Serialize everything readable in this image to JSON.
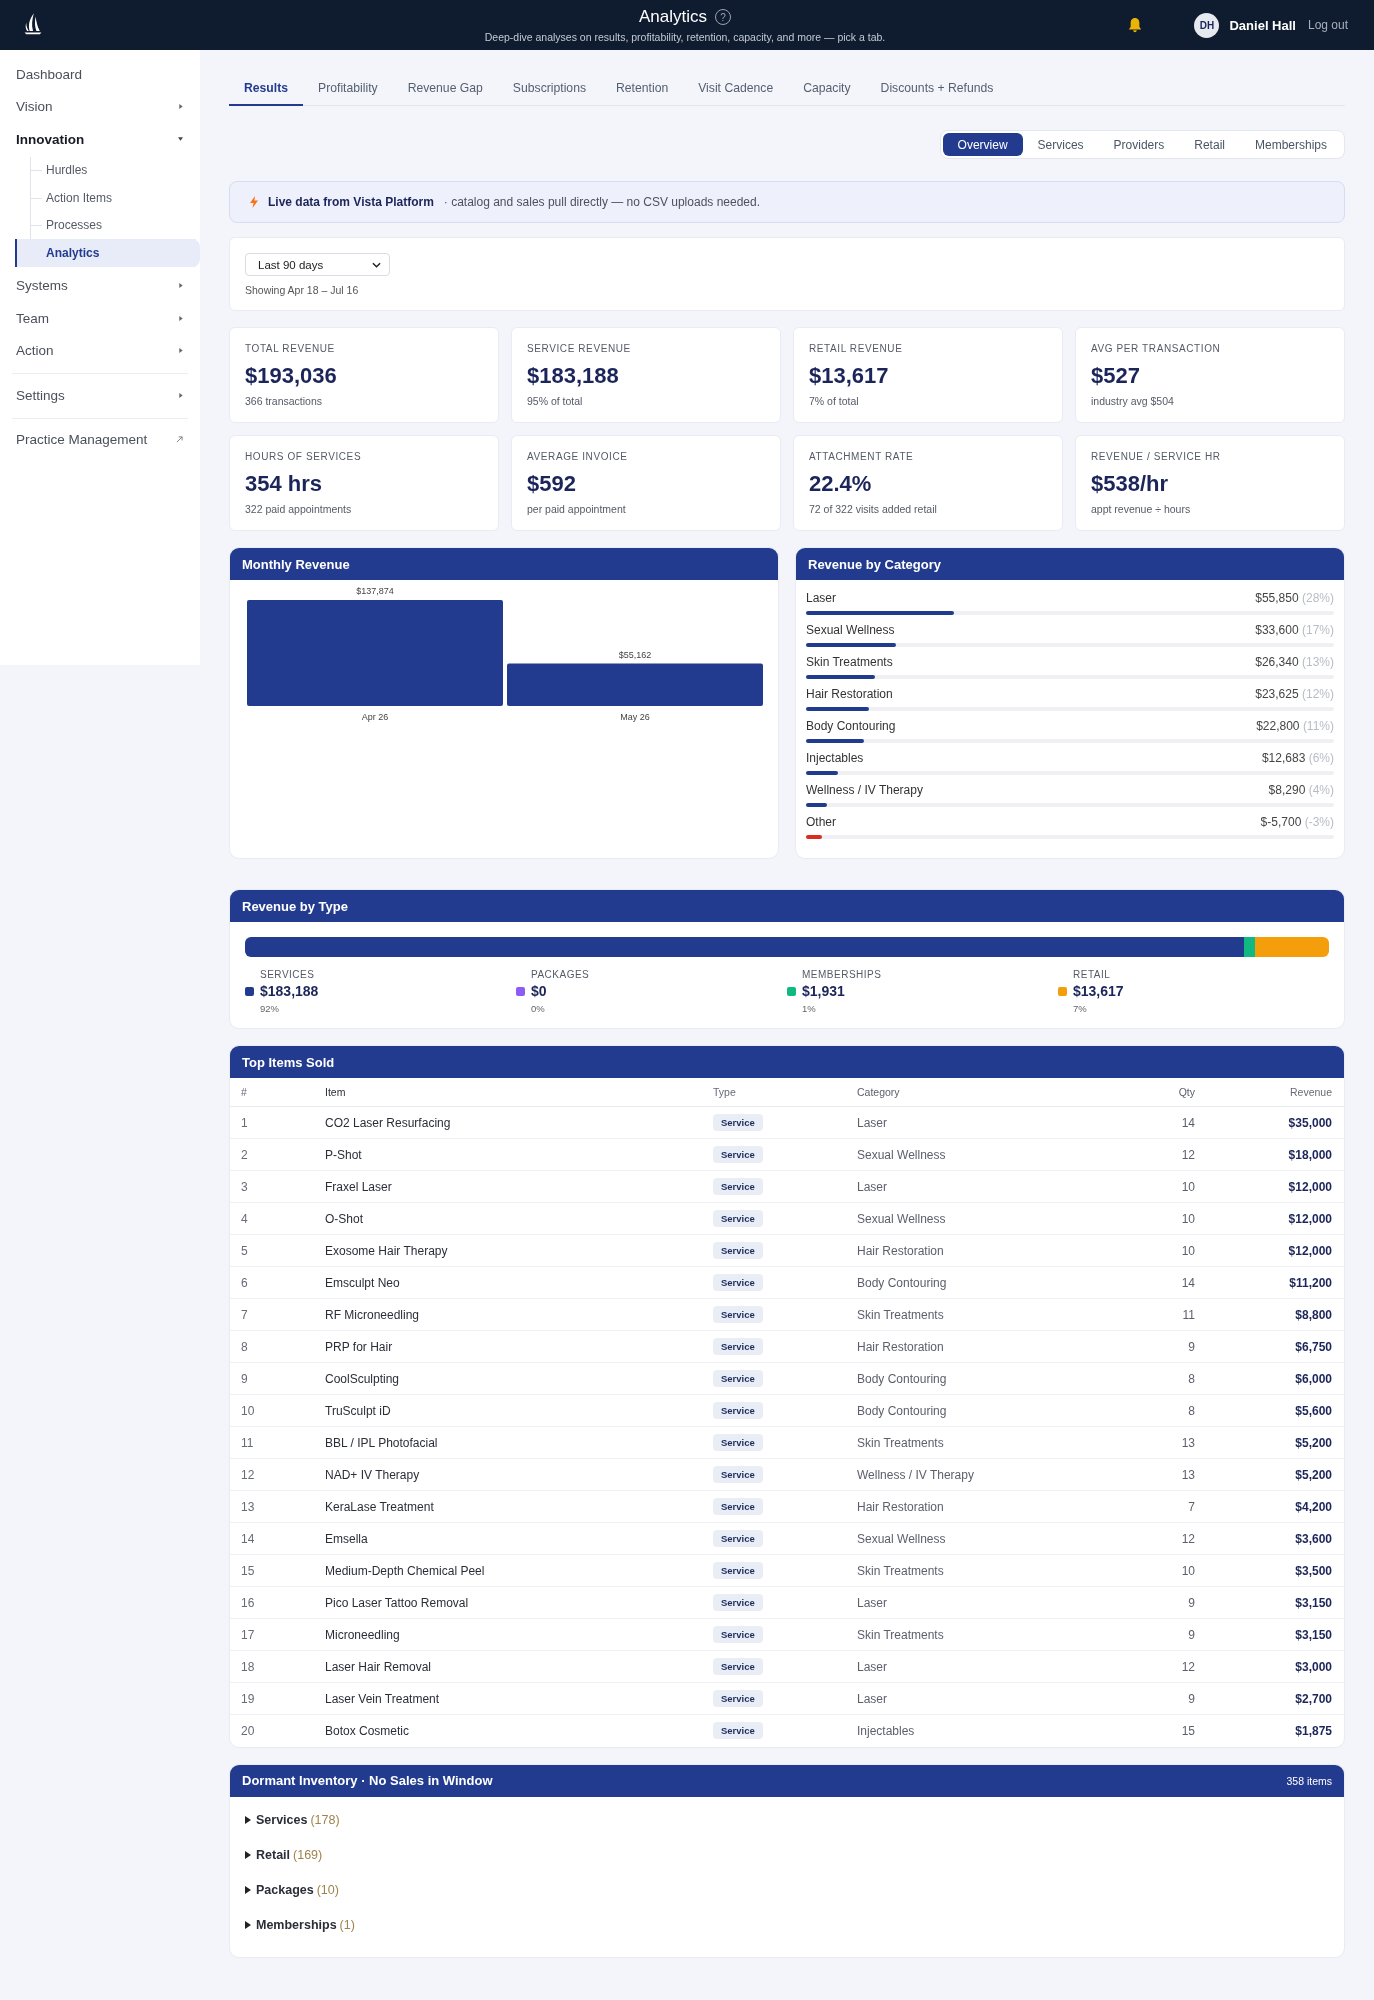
{
  "header": {
    "title": "Analytics",
    "help_button": "?",
    "subtitle": "Deep-dive analyses on results, profitability, retention, capacity, and more — pick a tab.",
    "user": {
      "initials": "DH",
      "name": "Daniel Hall"
    },
    "logout": "Log out"
  },
  "sidebar": {
    "sections": [
      {
        "items": [
          {
            "label": "Dashboard",
            "kind": "link",
            "selected": false
          },
          {
            "label": "Vision",
            "kind": "group",
            "expanded": false,
            "selected": false
          },
          {
            "label": "Innovation",
            "kind": "group",
            "expanded": true,
            "selected": false,
            "children": [
              {
                "label": "Hurdles",
                "selected": false
              },
              {
                "label": "Action Items",
                "selected": false
              },
              {
                "label": "Processes",
                "selected": false
              },
              {
                "label": "Analytics",
                "selected": true
              }
            ]
          },
          {
            "label": "Systems",
            "kind": "group",
            "expanded": false,
            "selected": false
          },
          {
            "label": "Team",
            "kind": "group",
            "expanded": false,
            "selected": false
          },
          {
            "label": "Action",
            "kind": "group",
            "expanded": false,
            "selected": false
          }
        ]
      },
      {
        "items": [
          {
            "label": "Settings",
            "kind": "group",
            "expanded": false,
            "selected": false
          }
        ]
      },
      {
        "items": [
          {
            "label": "Practice Management",
            "kind": "external",
            "selected": false
          }
        ]
      }
    ]
  },
  "tabs": [
    {
      "label": "Results",
      "selected": true
    },
    {
      "label": "Profitability",
      "selected": false
    },
    {
      "label": "Revenue Gap",
      "selected": false
    },
    {
      "label": "Subscriptions",
      "selected": false
    },
    {
      "label": "Retention",
      "selected": false
    },
    {
      "label": "Visit Cadence",
      "selected": false
    },
    {
      "label": "Capacity",
      "selected": false
    },
    {
      "label": "Discounts + Refunds",
      "selected": false
    }
  ],
  "subtabs": [
    {
      "label": "Overview",
      "selected": true
    },
    {
      "label": "Services",
      "selected": false
    },
    {
      "label": "Providers",
      "selected": false
    },
    {
      "label": "Retail",
      "selected": false
    },
    {
      "label": "Memberships",
      "selected": false
    }
  ],
  "banner": {
    "title": "Live data from Vista Platform",
    "text": "· catalog and sales pull directly — no CSV uploads needed."
  },
  "filter": {
    "period": "Last 90 days",
    "range": "Showing Apr 18 – Jul 16"
  },
  "kpis": [
    {
      "label": "TOTAL REVENUE",
      "value": "$193,036",
      "note": "366 transactions"
    },
    {
      "label": "SERVICE REVENUE",
      "value": "$183,188",
      "note": "95% of total"
    },
    {
      "label": "RETAIL REVENUE",
      "value": "$13,617",
      "note": "7% of total"
    },
    {
      "label": "AVG PER TRANSACTION",
      "value": "$527",
      "note": "industry avg $504"
    },
    {
      "label": "HOURS OF SERVICES",
      "value": "354 hrs",
      "note": "322 paid appointments"
    },
    {
      "label": "AVERAGE INVOICE",
      "value": "$592",
      "note": "per paid appointment"
    },
    {
      "label": "ATTACHMENT RATE",
      "value": "22.4%",
      "note": "72 of 322 visits added retail"
    },
    {
      "label": "REVENUE / SERVICE HR",
      "value": "$538/hr",
      "note": "appt revenue ÷ hours"
    }
  ],
  "monthly_revenue": {
    "title": "Monthly Revenue",
    "chart_data": {
      "type": "bar",
      "categories": [
        "Apr 26",
        "May 26"
      ],
      "values": [
        137874,
        55162
      ],
      "value_labels": [
        "$137,874",
        "$55,162"
      ],
      "ylim": [
        0,
        137874
      ]
    }
  },
  "revenue_by_category": {
    "title": "Revenue by Category",
    "categories": [
      {
        "name": "Laser",
        "amount": "$55,850",
        "share": "(28%)",
        "level": 0.28,
        "color": "#233b8e"
      },
      {
        "name": "Sexual Wellness",
        "amount": "$33,600",
        "share": "(17%)",
        "level": 0.17,
        "color": "#233b8e"
      },
      {
        "name": "Skin Treatments",
        "amount": "$26,340",
        "share": "(13%)",
        "level": 0.13,
        "color": "#233b8e"
      },
      {
        "name": "Hair Restoration",
        "amount": "$23,625",
        "share": "(12%)",
        "level": 0.12,
        "color": "#233b8e"
      },
      {
        "name": "Body Contouring",
        "amount": "$22,800",
        "share": "(11%)",
        "level": 0.11,
        "color": "#233b8e"
      },
      {
        "name": "Injectables",
        "amount": "$12,683",
        "share": "(6%)",
        "level": 0.06,
        "color": "#233b8e"
      },
      {
        "name": "Wellness / IV Therapy",
        "amount": "$8,290",
        "share": "(4%)",
        "level": 0.04,
        "color": "#233b8e"
      },
      {
        "name": "Other",
        "amount": "$-5,700",
        "share": "(-3%)",
        "level": 0.03,
        "color": "#d92d20"
      }
    ]
  },
  "revenue_by_type": {
    "title": "Revenue by Type",
    "types": [
      {
        "label": "SERVICES",
        "amount": "$183,188",
        "share": "92%",
        "color": "#233b8e"
      },
      {
        "label": "PACKAGES",
        "amount": "$0",
        "share": "0%",
        "color": "#8b5cf6"
      },
      {
        "label": "MEMBERSHIPS",
        "amount": "$1,931",
        "share": "1%",
        "color": "#10b981"
      },
      {
        "label": "RETAIL",
        "amount": "$13,617",
        "share": "7%",
        "color": "#f59e0b"
      }
    ]
  },
  "top_items": {
    "title": "Top Items Sold",
    "columns": [
      {
        "label": "#",
        "kind": "index"
      },
      {
        "label": "Item",
        "kind": "text"
      },
      {
        "label": "Type",
        "kind": "tag"
      },
      {
        "label": "Category",
        "kind": "muted"
      },
      {
        "label": "Qty",
        "kind": "number"
      },
      {
        "label": "Revenue",
        "kind": "amount"
      }
    ],
    "rows": [
      [
        "1",
        "CO2 Laser Resurfacing",
        "Service",
        "Laser",
        "14",
        "$35,000"
      ],
      [
        "2",
        "P-Shot",
        "Service",
        "Sexual Wellness",
        "12",
        "$18,000"
      ],
      [
        "3",
        "Fraxel Laser",
        "Service",
        "Laser",
        "10",
        "$12,000"
      ],
      [
        "4",
        "O-Shot",
        "Service",
        "Sexual Wellness",
        "10",
        "$12,000"
      ],
      [
        "5",
        "Exosome Hair Therapy",
        "Service",
        "Hair Restoration",
        "10",
        "$12,000"
      ],
      [
        "6",
        "Emsculpt Neo",
        "Service",
        "Body Contouring",
        "14",
        "$11,200"
      ],
      [
        "7",
        "RF Microneedling",
        "Service",
        "Skin Treatments",
        "11",
        "$8,800"
      ],
      [
        "8",
        "PRP for Hair",
        "Service",
        "Hair Restoration",
        "9",
        "$6,750"
      ],
      [
        "9",
        "CoolSculpting",
        "Service",
        "Body Contouring",
        "8",
        "$6,000"
      ],
      [
        "10",
        "TruSculpt iD",
        "Service",
        "Body Contouring",
        "8",
        "$5,600"
      ],
      [
        "11",
        "BBL / IPL Photofacial",
        "Service",
        "Skin Treatments",
        "13",
        "$5,200"
      ],
      [
        "12",
        "NAD+ IV Therapy",
        "Service",
        "Wellness / IV Therapy",
        "13",
        "$5,200"
      ],
      [
        "13",
        "KeraLase Treatment",
        "Service",
        "Hair Restoration",
        "7",
        "$4,200"
      ],
      [
        "14",
        "Emsella",
        "Service",
        "Sexual Wellness",
        "12",
        "$3,600"
      ],
      [
        "15",
        "Medium-Depth Chemical Peel",
        "Service",
        "Skin Treatments",
        "10",
        "$3,500"
      ],
      [
        "16",
        "Pico Laser Tattoo Removal",
        "Service",
        "Laser",
        "9",
        "$3,150"
      ],
      [
        "17",
        "Microneedling",
        "Service",
        "Skin Treatments",
        "9",
        "$3,150"
      ],
      [
        "18",
        "Laser Hair Removal",
        "Service",
        "Laser",
        "12",
        "$3,000"
      ],
      [
        "19",
        "Laser Vein Treatment",
        "Service",
        "Laser",
        "9",
        "$2,700"
      ],
      [
        "20",
        "Botox Cosmetic",
        "Service",
        "Injectables",
        "15",
        "$1,875"
      ]
    ]
  },
  "dormant": {
    "title": "Dormant Inventory · No Sales in Window",
    "count": "358 items",
    "groups": [
      {
        "label": "Services",
        "count": "(178)",
        "expanded": false
      },
      {
        "label": "Retail",
        "count": "(169)",
        "expanded": false
      },
      {
        "label": "Packages",
        "count": "(10)",
        "expanded": false
      },
      {
        "label": "Memberships",
        "count": "(1)",
        "expanded": false
      }
    ]
  }
}
